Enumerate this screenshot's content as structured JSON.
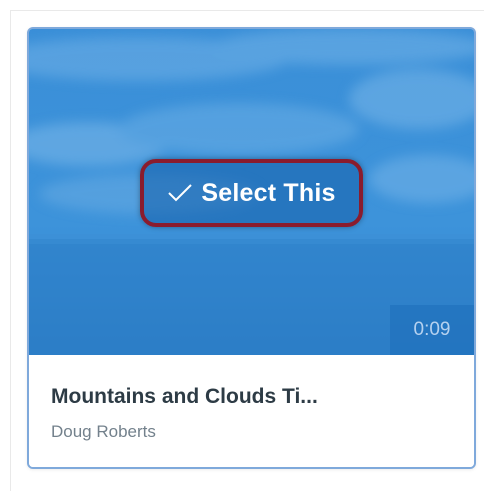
{
  "video_card": {
    "select_button_label": "Select This",
    "select_icon": "checkmark-icon",
    "duration": "0:09",
    "title": "Mountains and Clouds Ti...",
    "author": "Doug Roberts"
  },
  "colors": {
    "thumbnail_tint": "#2f86d3",
    "card_border": "#7fa9db",
    "highlight_border": "#8a1c2e",
    "title_text": "#2d3b45",
    "author_text": "#73818c"
  }
}
